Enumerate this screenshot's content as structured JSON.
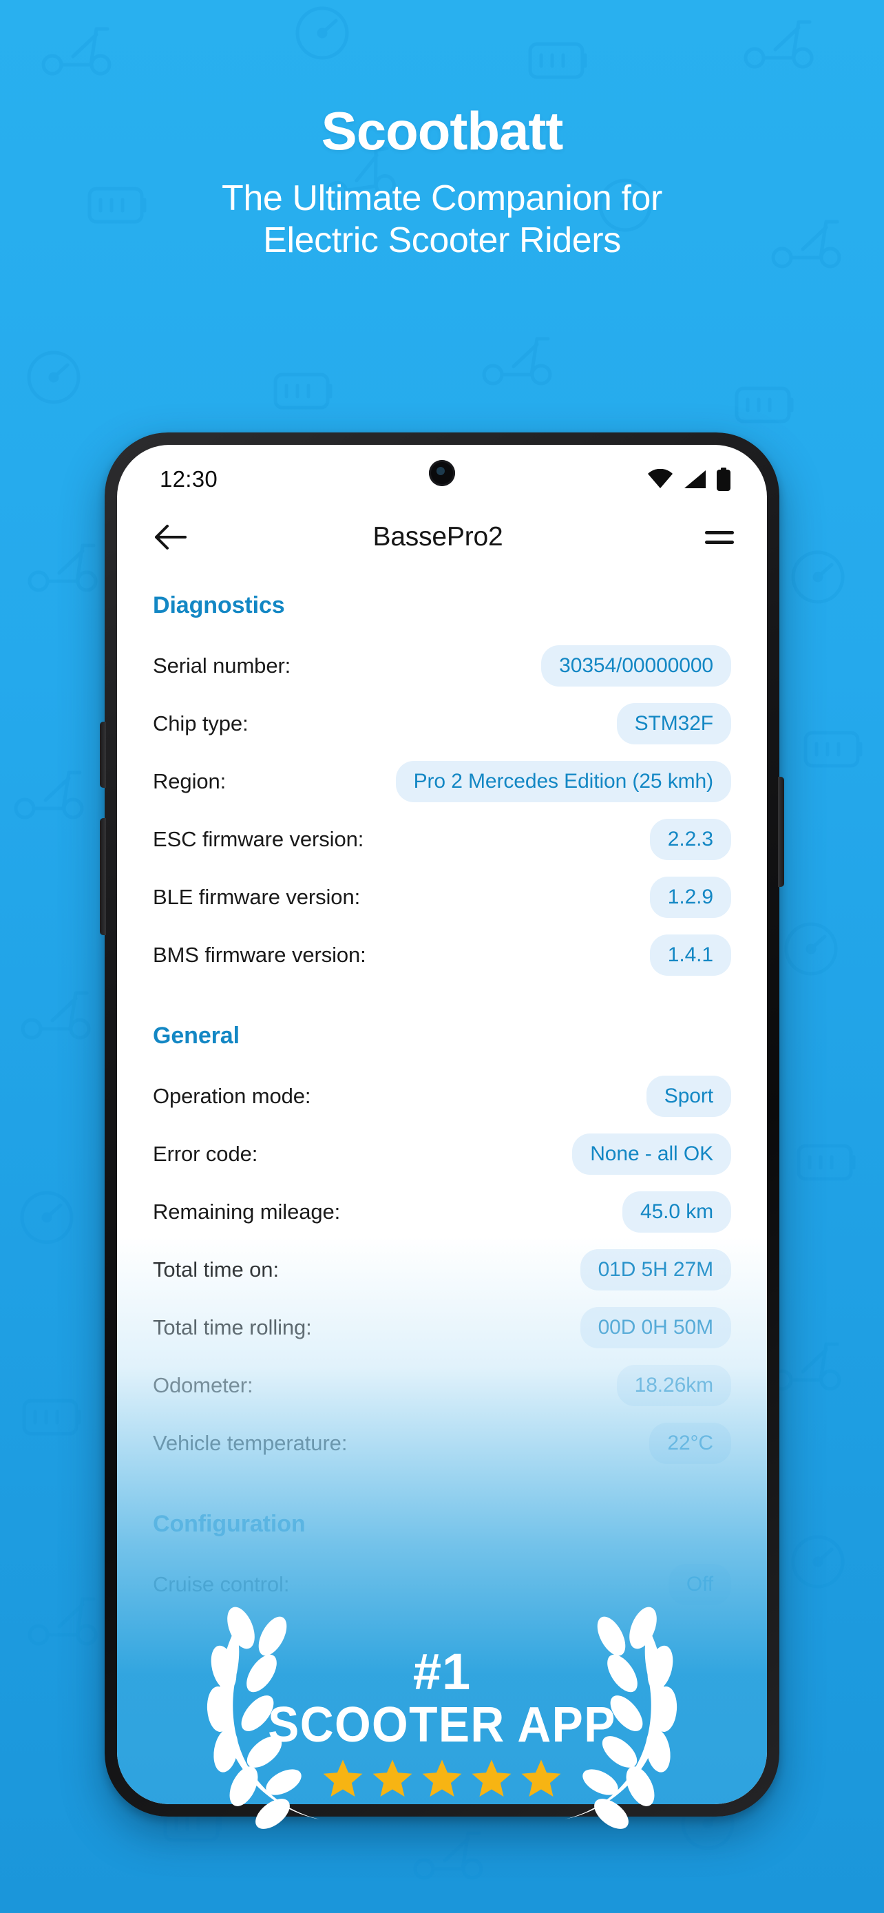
{
  "hero": {
    "title": "Scootbatt",
    "tagline_line1": "The Ultimate Companion for",
    "tagline_line2": "Electric Scooter Riders"
  },
  "colors": {
    "background_top": "#29b0ef",
    "background_bottom": "#1b96da",
    "accent_blue": "#1387c4",
    "pill_background": "#e3f0fb",
    "star_gold": "#f7b413",
    "phone_body": "#171719"
  },
  "phone": {
    "status_bar": {
      "time": "12:30",
      "icons": [
        "wifi-icon",
        "cellular-signal-icon",
        "battery-icon"
      ]
    },
    "app_bar": {
      "back_icon": "arrow-left-icon",
      "title": "BassePro2",
      "menu_icon": "hamburger-menu-icon"
    },
    "sections": [
      {
        "id": "diagnostics",
        "header": "Diagnostics",
        "rows": [
          {
            "label": "Serial number:",
            "value": "30354/00000000"
          },
          {
            "label": "Chip type:",
            "value": "STM32F"
          },
          {
            "label": "Region:",
            "value": "Pro 2 Mercedes Edition (25 kmh)"
          },
          {
            "label": "ESC firmware version:",
            "value": "2.2.3"
          },
          {
            "label": "BLE firmware version:",
            "value": "1.2.9"
          },
          {
            "label": "BMS firmware version:",
            "value": "1.4.1"
          }
        ]
      },
      {
        "id": "general",
        "header": "General",
        "rows": [
          {
            "label": "Operation mode:",
            "value": "Sport"
          },
          {
            "label": "Error code:",
            "value": "None - all OK"
          },
          {
            "label": "Remaining mileage:",
            "value": "45.0 km"
          },
          {
            "label": "Total time on:",
            "value": "01D 5H 27M"
          },
          {
            "label": "Total time rolling:",
            "value": "00D 0H 50M"
          },
          {
            "label": "Odometer:",
            "value": "18.26km"
          },
          {
            "label": "Vehicle temperature:",
            "value": "22°C"
          }
        ]
      },
      {
        "id": "configuration",
        "header": "Configuration",
        "rows": [
          {
            "label": "Cruise control:",
            "value": "Off"
          }
        ]
      }
    ]
  },
  "award_badge": {
    "rank": "#1",
    "label": "SCOOTER APP",
    "star_count": 5,
    "left_icon": "laurel-wreath-left-icon",
    "right_icon": "laurel-wreath-right-icon"
  }
}
